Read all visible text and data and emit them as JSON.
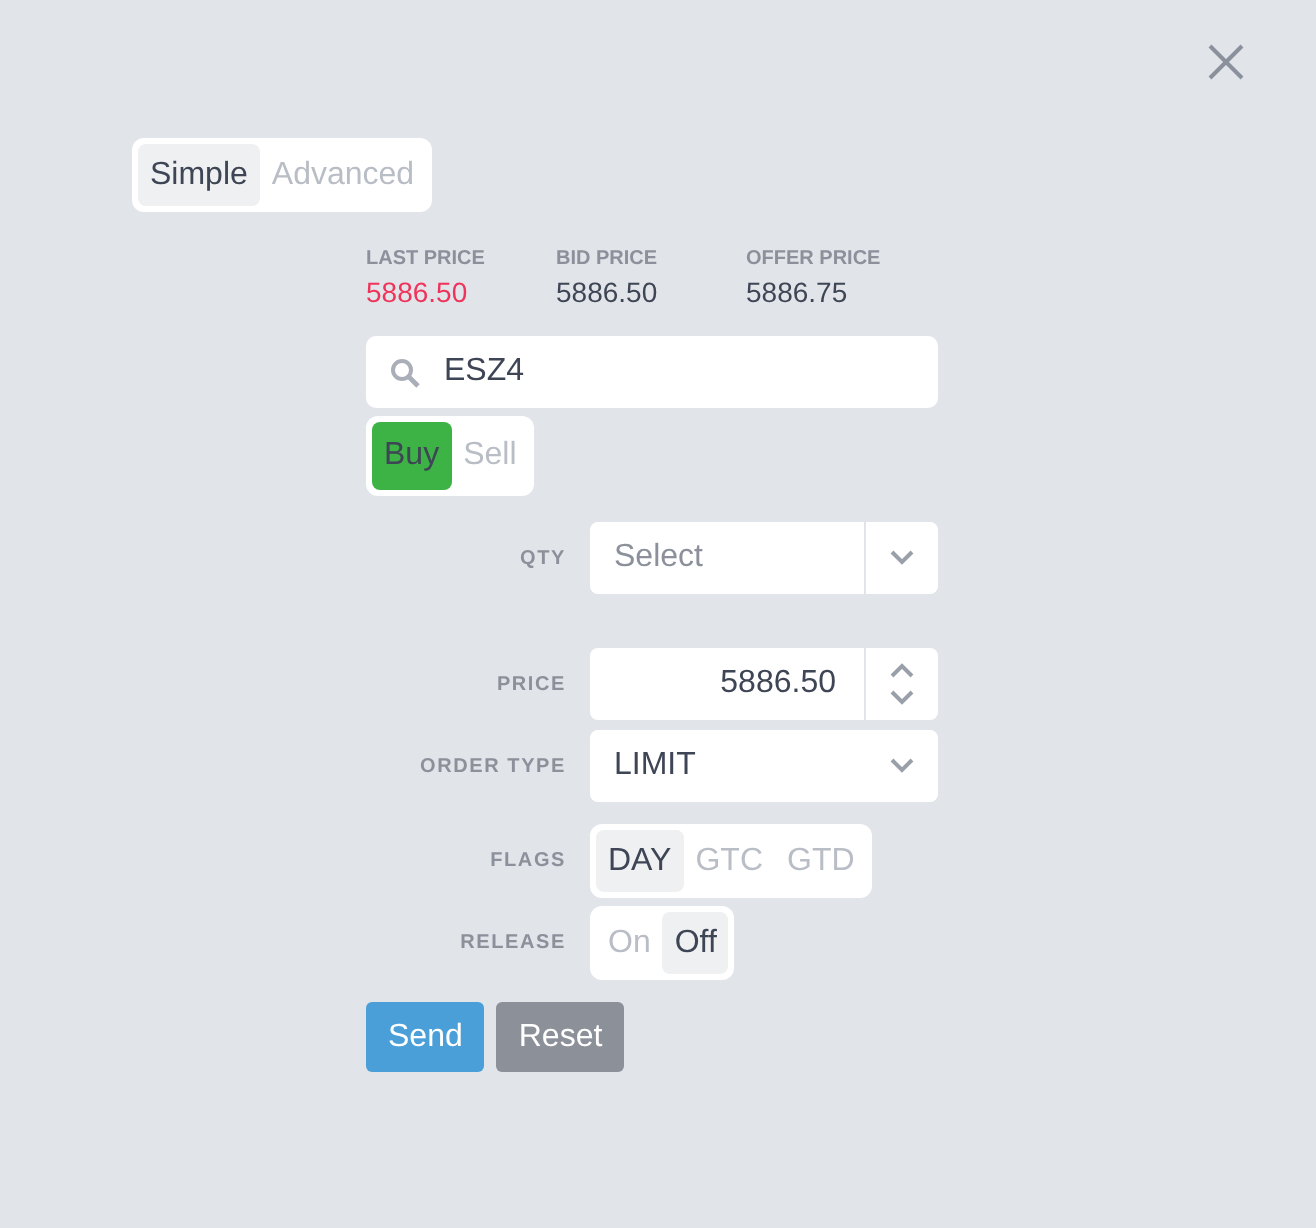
{
  "modes": [
    {
      "label": "Simple",
      "selected": true
    },
    {
      "label": "Advanced",
      "selected": false
    }
  ],
  "prices": [
    {
      "label": "LAST PRICE",
      "value": "5886.50",
      "kind": "last"
    },
    {
      "label": "BID PRICE",
      "value": "5886.50",
      "kind": "bid"
    },
    {
      "label": "OFFER PRICE",
      "value": "5886.75",
      "kind": "offer"
    }
  ],
  "search": {
    "value": "ESZ4"
  },
  "sides": [
    {
      "label": "Buy",
      "selected": true
    },
    {
      "label": "Sell",
      "selected": false
    }
  ],
  "qty": {
    "label": "QTY",
    "placeholder": "Select"
  },
  "price": {
    "label": "PRICE",
    "value": "5886.50"
  },
  "order_type": {
    "label": "ORDER TYPE",
    "value": "LIMIT"
  },
  "flags": {
    "label": "FLAGS",
    "options": [
      {
        "label": "DAY",
        "selected": true
      },
      {
        "label": "GTC",
        "selected": false
      },
      {
        "label": "GTD",
        "selected": false
      }
    ]
  },
  "release": {
    "label": "RELEASE",
    "options": [
      {
        "label": "On",
        "selected": false
      },
      {
        "label": "Off",
        "selected": true
      }
    ]
  },
  "buttons": [
    {
      "label": "Send",
      "kind": "primary"
    },
    {
      "label": "Reset",
      "kind": "secondary"
    }
  ]
}
